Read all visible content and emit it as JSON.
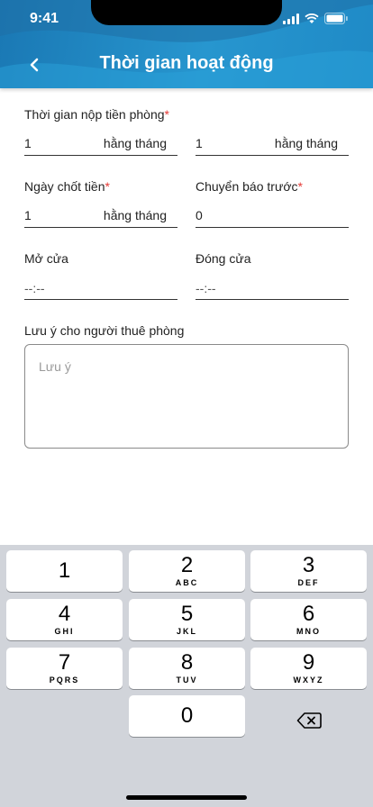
{
  "status": {
    "time": "9:41"
  },
  "header": {
    "title": "Thời gian hoạt động"
  },
  "form": {
    "payment_time": {
      "label": "Thời gian nộp tiền phòng",
      "required": "*",
      "from_value": "1",
      "from_suffix": "hằng tháng",
      "to_value": "1",
      "to_suffix": "hằng tháng"
    },
    "closing_day": {
      "label": "Ngày chốt tiền",
      "required": "*",
      "value": "1",
      "suffix": "hằng tháng"
    },
    "notice": {
      "label": "Chuyển báo trước",
      "required": "*",
      "value": "0"
    },
    "open": {
      "label": "Mở cửa",
      "value": "--:--"
    },
    "close": {
      "label": "Đóng cửa",
      "value": "--:--"
    },
    "note": {
      "label": "Lưu ý cho người thuê phòng",
      "placeholder": "Lưu ý"
    }
  },
  "keyboard": {
    "keys": [
      {
        "num": "1",
        "letters": ""
      },
      {
        "num": "2",
        "letters": "ABC"
      },
      {
        "num": "3",
        "letters": "DEF"
      },
      {
        "num": "4",
        "letters": "GHI"
      },
      {
        "num": "5",
        "letters": "JKL"
      },
      {
        "num": "6",
        "letters": "MNO"
      },
      {
        "num": "7",
        "letters": "PQRS"
      },
      {
        "num": "8",
        "letters": "TUV"
      },
      {
        "num": "9",
        "letters": "WXYZ"
      },
      {
        "num": "0",
        "letters": ""
      }
    ]
  },
  "colors": {
    "header": "#2796cf",
    "required": "#e53935",
    "keyboard_bg": "#d1d4da"
  }
}
